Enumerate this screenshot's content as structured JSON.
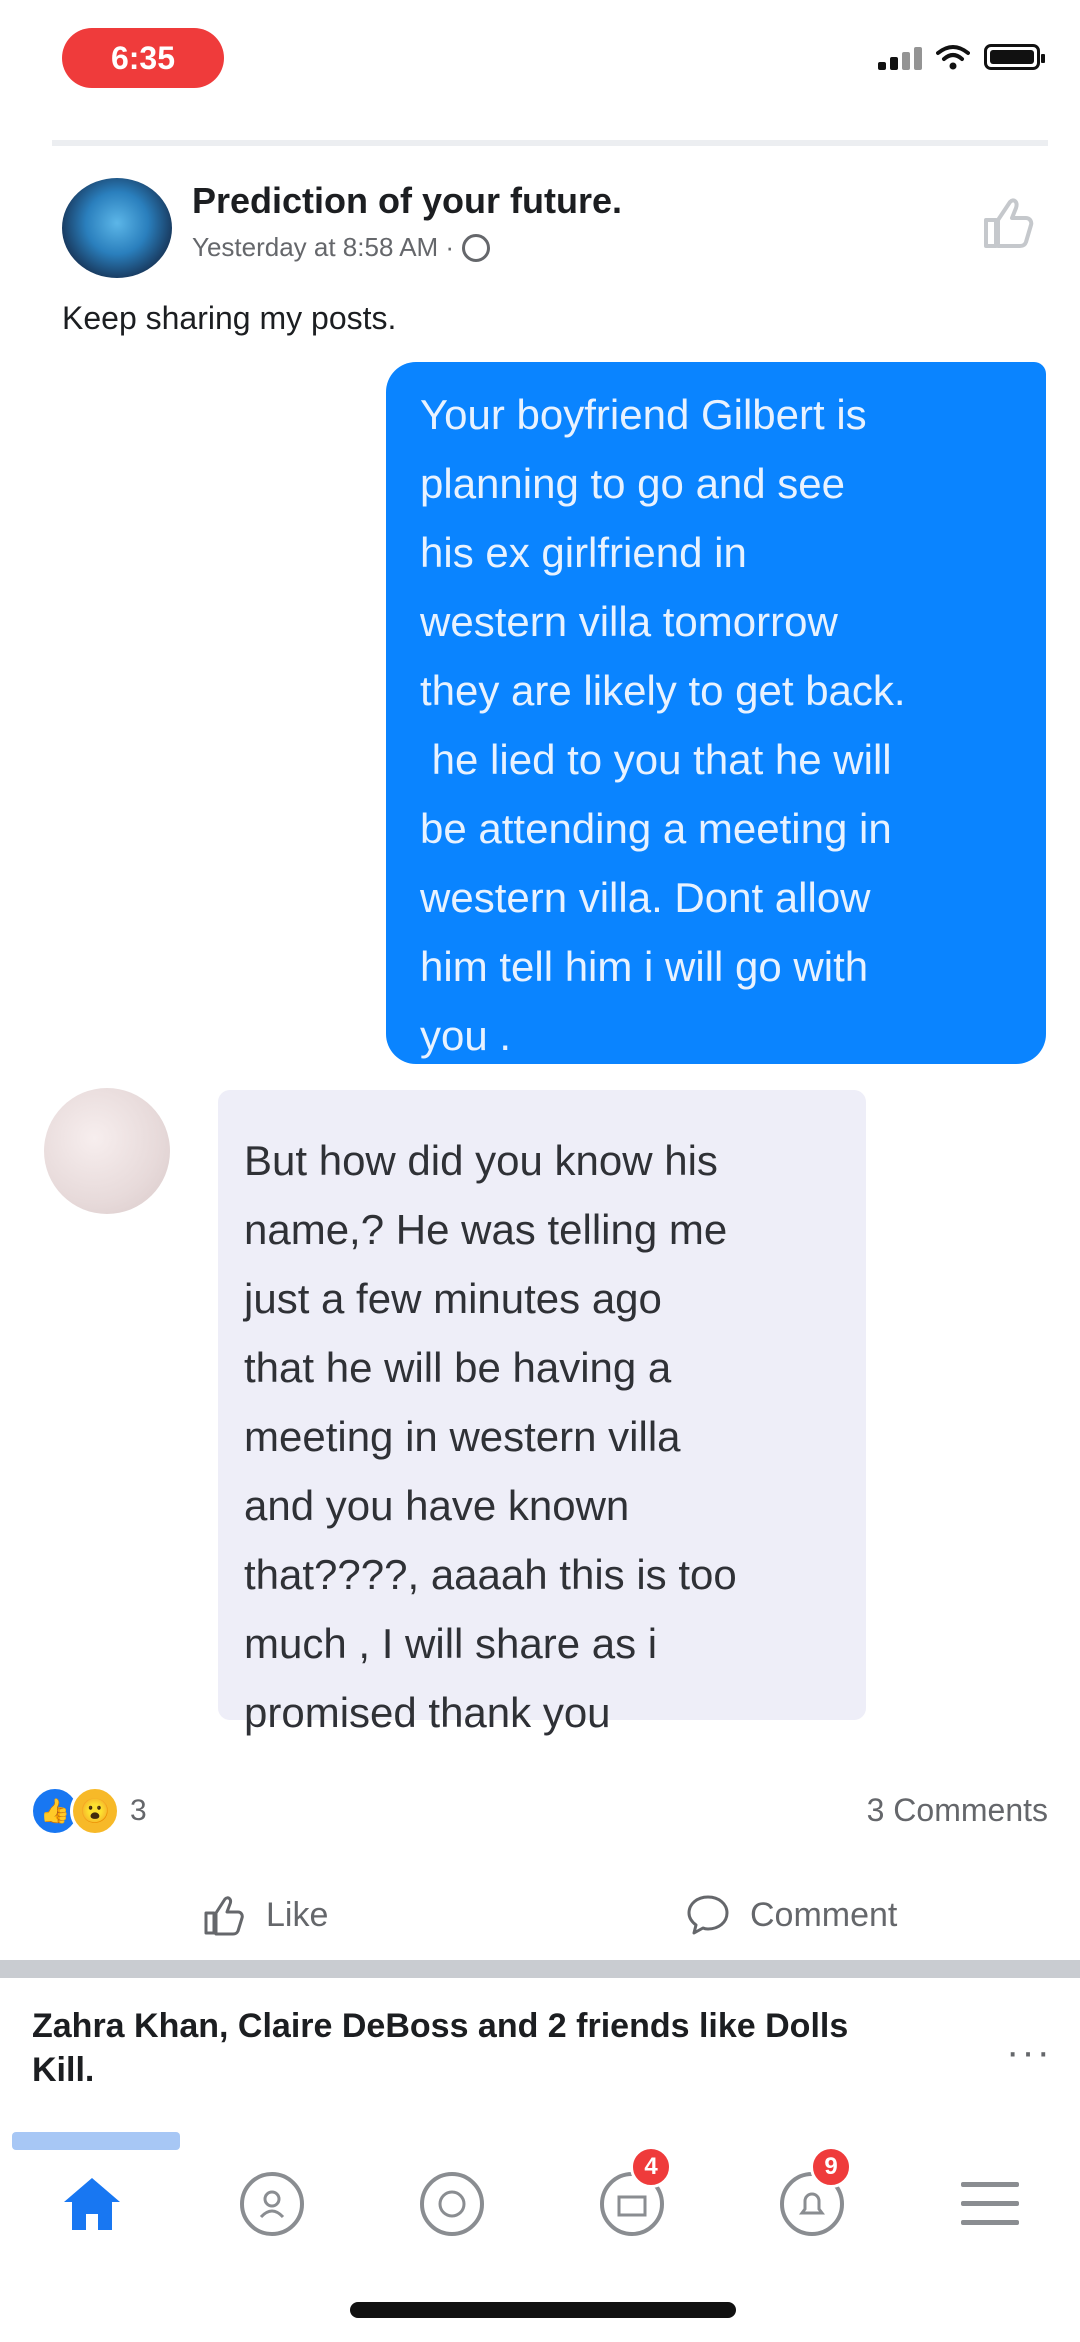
{
  "status_bar": {
    "time": "6:35"
  },
  "post": {
    "page_name": "Prediction of your future.",
    "meta": "Yesterday at 8:58 AM ·",
    "text": "Keep sharing my posts."
  },
  "chat": {
    "outgoing": [
      "Your boyfriend Gilbert is",
      "planning to go and see",
      "his ex girlfriend in",
      "western villa tomorrow",
      "they are likely to get back.",
      " he lied to you that he will",
      "be attending a meeting in",
      "western villa. Dont allow",
      "him tell him i will go with",
      "you ."
    ],
    "incoming": [
      "But how did you know his",
      "name,? He was telling me",
      "just a few minutes ago",
      "that he will be having a",
      "meeting in western villa",
      "and you have known",
      "that????, aaaah this is too",
      "much , I will share as i",
      "promised thank you"
    ]
  },
  "reactions": {
    "count": "3",
    "comments": "3 Comments"
  },
  "actions": {
    "like": "Like",
    "comment": "Comment"
  },
  "friends_activity": "Zahra Khan, Claire DeBoss and 2 friends like Dolls Kill.",
  "nav": {
    "badges": {
      "marketplace": "4",
      "notifications": "9"
    },
    "colors": {
      "active": "#1877f2",
      "inactive": "#8a8d91",
      "badge": "#ef3b3b"
    }
  }
}
